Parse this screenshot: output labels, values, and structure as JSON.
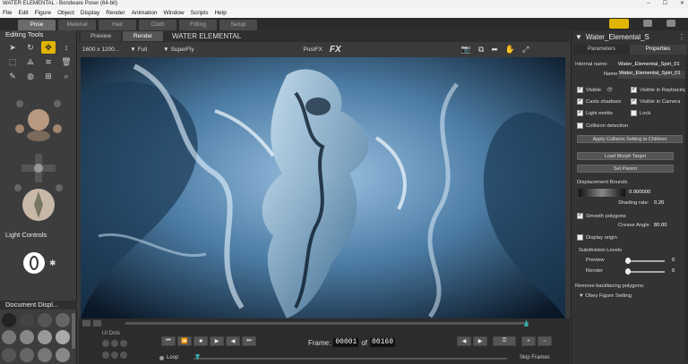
{
  "app": {
    "title": "WATER ELEMENTAL - Bondware Poser (64-bit)"
  },
  "menu": [
    "File",
    "Edit",
    "Figure",
    "Object",
    "Display",
    "Render",
    "Animation",
    "Window",
    "Scripts",
    "Help"
  ],
  "rooms": [
    "Pose",
    "Material",
    "Hair",
    "Cloth",
    "Fitting",
    "Setup"
  ],
  "left_panel": {
    "editing_tools_title": "Editing Tools",
    "light_controls_title": "Light Controls",
    "document_display_title": "Document  Displ..."
  },
  "viewport_tabs": [
    "Preview",
    "Render"
  ],
  "camera_title": "WATER ELEMENTAL",
  "render_toolbar": {
    "resolution": "1600 x 1200...",
    "quality": "Full",
    "engine": "SuperFly",
    "postfx": "PostFX",
    "fx": "FX"
  },
  "timeline": {
    "ui_dots": "UI Dots",
    "frame_label": "Frame:",
    "frame_current": "00001",
    "of_label": "of",
    "frame_total": "00160",
    "loop_label": "Loop",
    "skip_frames_label": "Skip Frames"
  },
  "right_panel": {
    "figure_title": "Water_Elemental_S",
    "tabs": [
      "Parameters",
      "Properties"
    ],
    "internal_name_label": "Internal name:",
    "internal_name_value": "Water_Elemental_Spiri_01",
    "name_label": "Name:",
    "name_value": "Water_Elemental_Spiri_01",
    "visible": "Visible",
    "visible_raytracing": "Visible in Raytracing",
    "casts_shadows": "Casts shadows",
    "visible_camera": "Visible in Camera",
    "light_emitter": "Light emitte",
    "lock": "Lock",
    "collision_detection": "Collision detection",
    "apply_collision_btn": "Apply Collision Setting to Children",
    "load_morph_btn": "Load Morph Target",
    "set_parent_btn": "Set Parent",
    "displacement_bounds_label": "Displacement Bounds",
    "displacement_bounds_value": "0.000000",
    "shading_rate_label": "Shading rate:",
    "shading_rate_value": "0.20",
    "smooth_polygons": "Smooth polygons",
    "crease_angle_label": "Crease Angle",
    "crease_angle_value": "80.00",
    "display_origin": "Display origin",
    "subdivision_levels": "Subdivision Levels",
    "preview_label": "Preview",
    "preview_value": "0",
    "render_label": "Render",
    "render_value": "0",
    "remove_backfacing": "Remove backfacing polygons:",
    "obey_figure": "Obey Figure Setting"
  },
  "colors": {
    "accent_yellow": "#e0b400",
    "panel_bg": "#333333",
    "water_light": "#7fb3d9",
    "water_dark": "#0c1a2a"
  }
}
